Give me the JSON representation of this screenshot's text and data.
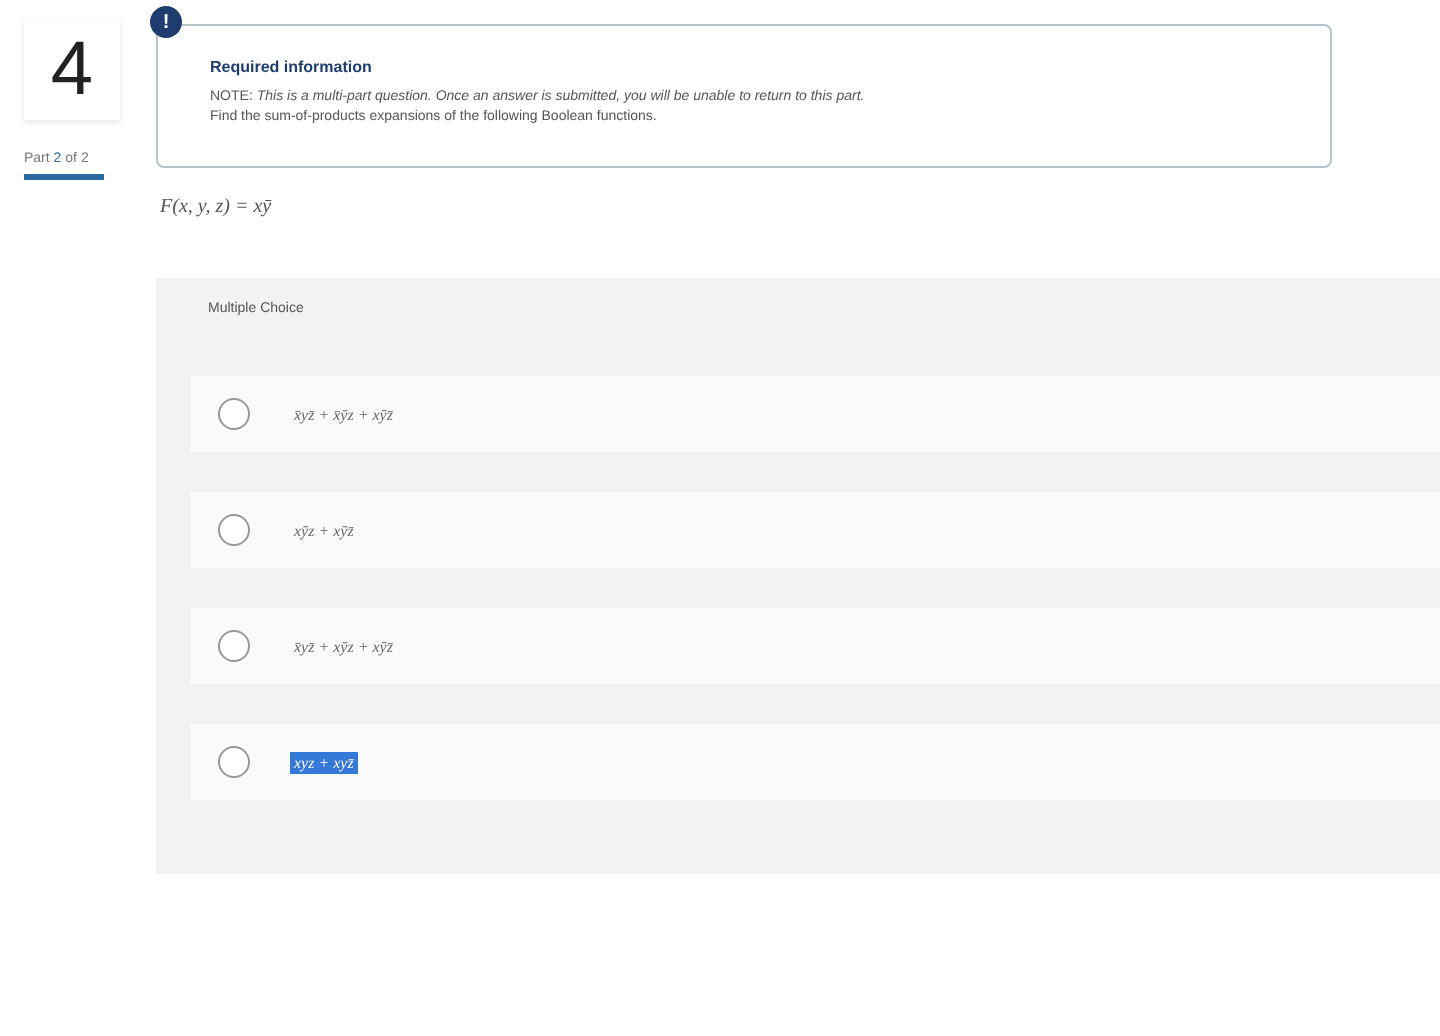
{
  "question": {
    "number": "4",
    "part": {
      "label": "Part",
      "current": "2",
      "of": "of 2"
    }
  },
  "notice": {
    "badge": "!",
    "title": "Required information",
    "note_label": "NOTE:",
    "note": "This is a multi-part question. Once an answer is submitted, you will be unable to return to this part.",
    "instruction": "Find the sum-of-products expansions of the following Boolean functions."
  },
  "function": "F(x, y, z) = xȳ",
  "multiple_choice": {
    "heading": "Multiple Choice",
    "options": [
      {
        "text": "x̄yz̄ + x̄ȳz + xȳz̄",
        "selected": false,
        "highlighted": false
      },
      {
        "text": "xȳz + xȳz̄",
        "selected": false,
        "highlighted": false
      },
      {
        "text": "x̄yz̄ + xȳz + xȳz̄",
        "selected": false,
        "highlighted": false
      },
      {
        "text": "xyz + xyz̄",
        "selected": false,
        "highlighted": true
      }
    ]
  }
}
